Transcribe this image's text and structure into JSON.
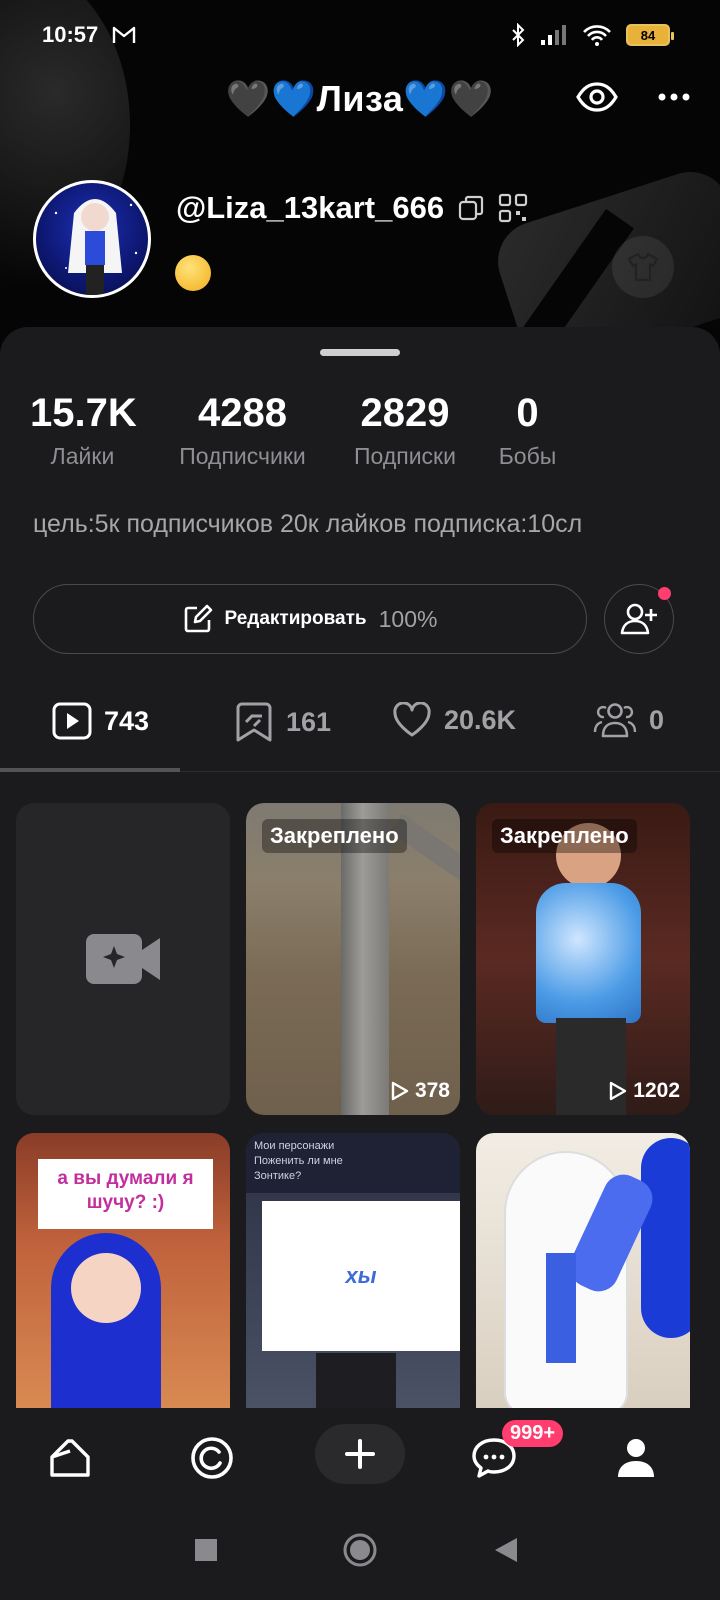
{
  "status_bar": {
    "time": "10:57",
    "battery": "84"
  },
  "header": {
    "title": "🖤💙Лиза💙🖤",
    "username": "@Liza_13kart_666"
  },
  "stats": [
    {
      "value": "15.7K",
      "label": "Лайки"
    },
    {
      "value": "4288",
      "label": "Подписчики"
    },
    {
      "value": "2829",
      "label": "Подписки"
    },
    {
      "value": "0",
      "label": "Бобы"
    }
  ],
  "bio": "цель:5к подписчиков 20к лайков подписка:10сл",
  "edit": {
    "label": "Редактировать",
    "percent": "100%"
  },
  "tabs": [
    {
      "icon": "play-icon",
      "count": "743"
    },
    {
      "icon": "repost-icon",
      "count": "161"
    },
    {
      "icon": "heart-icon",
      "count": "20.6K"
    },
    {
      "icon": "friends-icon",
      "count": "0"
    }
  ],
  "grid": {
    "pinned_label": "Закреплено",
    "videos": [
      {
        "views": "378"
      },
      {
        "views": "1202"
      }
    ],
    "captions": {
      "gacha1": "а вы думали я шучу? :)",
      "gacha2_top_line1": "Мои персонажи",
      "gacha2_top_line2": "Поженить ли мне",
      "gacha2_top_line3": "Зонтике?",
      "gacha2_box": "хы"
    }
  },
  "bottom_nav": {
    "messages_badge": "999+"
  },
  "colors": {
    "accent_pink": "#ff3d6e",
    "sheet_bg": "#1b1b1d",
    "muted_text": "#8e8e93"
  }
}
